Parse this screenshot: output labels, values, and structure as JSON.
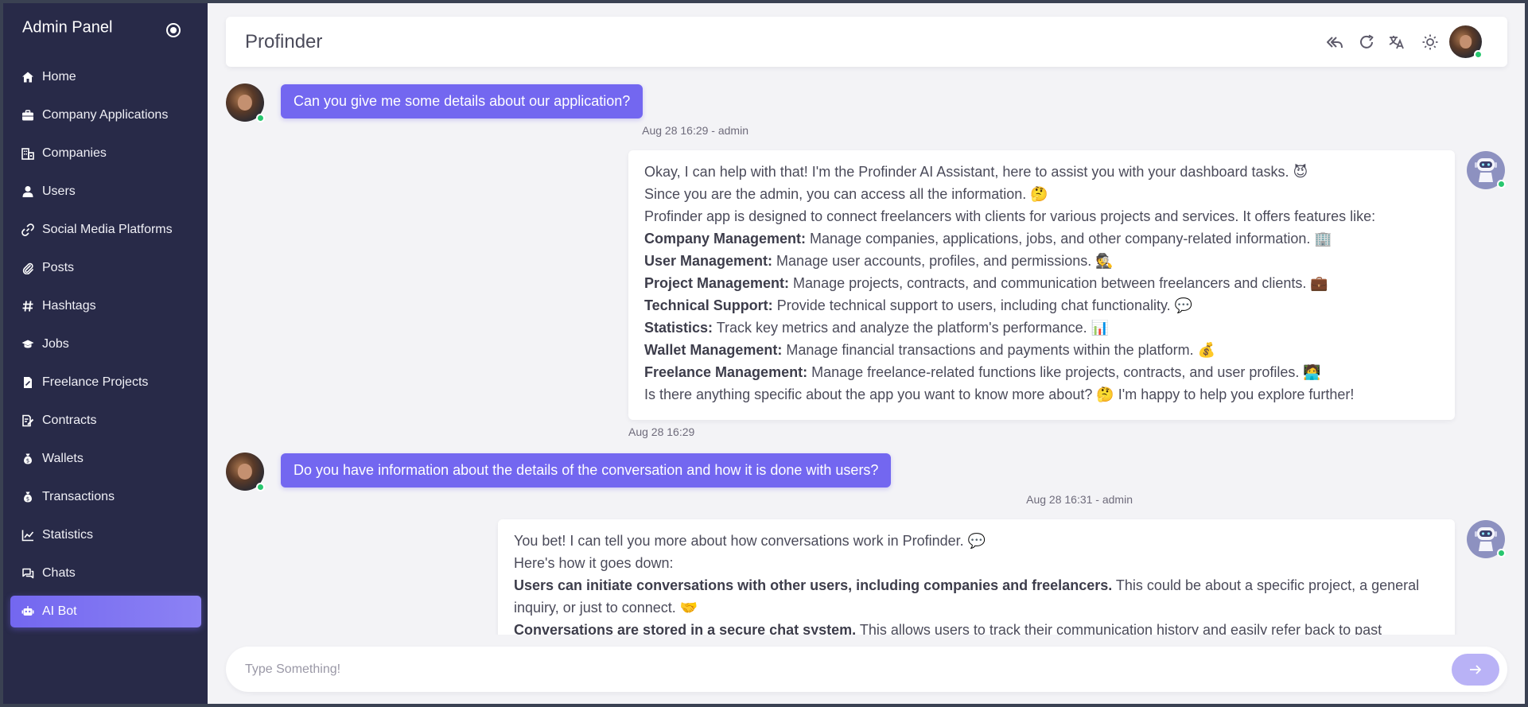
{
  "sidebar": {
    "title": "Admin Panel",
    "items": [
      {
        "label": "Home",
        "icon": "home-icon"
      },
      {
        "label": "Company Applications",
        "icon": "briefcase-icon"
      },
      {
        "label": "Companies",
        "icon": "building-icon"
      },
      {
        "label": "Users",
        "icon": "user-icon"
      },
      {
        "label": "Social Media Platforms",
        "icon": "link-icon"
      },
      {
        "label": "Posts",
        "icon": "paperclip-icon"
      },
      {
        "label": "Hashtags",
        "icon": "hashtag-icon"
      },
      {
        "label": "Jobs",
        "icon": "graduation-cap-icon"
      },
      {
        "label": "Freelance Projects",
        "icon": "file-edit-icon"
      },
      {
        "label": "Contracts",
        "icon": "contract-icon"
      },
      {
        "label": "Wallets",
        "icon": "money-bag-icon"
      },
      {
        "label": "Transactions",
        "icon": "money-bag-icon"
      },
      {
        "label": "Statistics",
        "icon": "line-chart-icon"
      },
      {
        "label": "Chats",
        "icon": "chat-icon"
      },
      {
        "label": "AI Bot",
        "icon": "robot-icon",
        "active": true
      }
    ]
  },
  "topbar": {
    "title": "Profinder",
    "icons": [
      "reply-all-icon",
      "refresh-icon",
      "translate-icon",
      "sun-icon",
      "user-avatar"
    ]
  },
  "messages": {
    "m1": {
      "text": "Can you give me some details about our application?",
      "meta": "Aug 28 16:29 - admin"
    },
    "m2": {
      "lines": [
        {
          "text": "Okay, I can help with that! I'm the Profinder AI Assistant, here to assist you with your dashboard tasks. 😈"
        },
        {
          "text": "Since you are the admin, you can access all the information. 🤔"
        },
        {
          "text": "Profinder app is designed to connect freelancers with clients for various projects and services. It offers features like:"
        },
        {
          "bold": "Company Management:",
          "text": " Manage companies, applications, jobs, and other company-related information. 🏢"
        },
        {
          "bold": "User Management:",
          "text": " Manage user accounts, profiles, and permissions. 🕵️"
        },
        {
          "bold": "Project Management:",
          "text": " Manage projects, contracts, and communication between freelancers and clients. 💼"
        },
        {
          "bold": "Technical Support:",
          "text": " Provide technical support to users, including chat functionality. 💬"
        },
        {
          "bold": "Statistics:",
          "text": " Track key metrics and analyze the platform's performance. 📊"
        },
        {
          "bold": "Wallet Management:",
          "text": " Manage financial transactions and payments within the platform. 💰"
        },
        {
          "bold": "Freelance Management:",
          "text": " Manage freelance-related functions like projects, contracts, and user profiles. 🧑‍💻"
        },
        {
          "text": "Is there anything specific about the app you want to know more about? 🤔 I'm happy to help you explore further!"
        }
      ],
      "meta": "Aug 28 16:29"
    },
    "m3": {
      "text": "Do you have information about the details of the conversation and how it is done with users?",
      "meta": "Aug 28 16:31 - admin"
    },
    "m4": {
      "lines": [
        {
          "text": "You bet! I can tell you more about how conversations work in Profinder. 💬"
        },
        {
          "text": "Here's how it goes down:"
        },
        {
          "bold": "Users can initiate conversations with other users, including companies and freelancers.",
          "text": " This could be about a specific project, a general inquiry, or just to connect. 🤝"
        },
        {
          "bold": "Conversations are stored in a secure chat system.",
          "text": " This allows users to track their communication history and easily refer back to past"
        }
      ]
    }
  },
  "input": {
    "placeholder": "Type Something!",
    "value": ""
  },
  "colors": {
    "sidebar_bg": "#282a48",
    "accent": "#7367f0",
    "online": "#28c76f"
  }
}
